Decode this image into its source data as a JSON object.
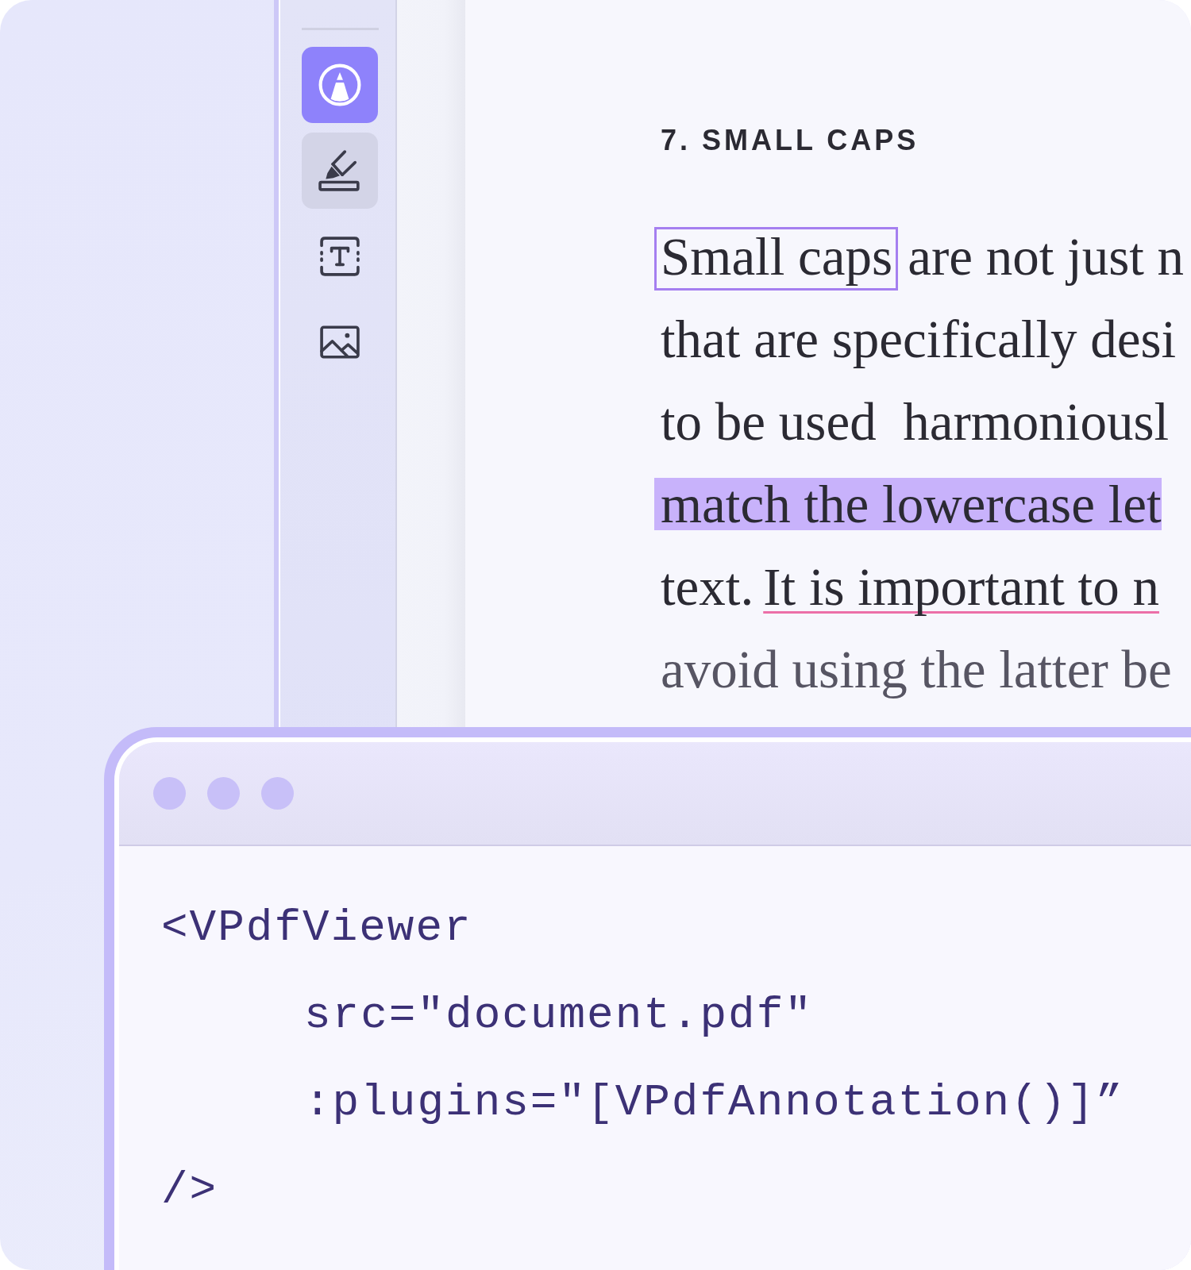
{
  "toolbar": {
    "tools": [
      {
        "kind": "pen",
        "selected": true,
        "hovered": false
      },
      {
        "kind": "highlighter",
        "selected": false,
        "hovered": true
      },
      {
        "kind": "text",
        "selected": false,
        "hovered": false
      },
      {
        "kind": "image",
        "selected": false,
        "hovered": false
      }
    ]
  },
  "page": {
    "heading": "7. SMALL CAPS",
    "lines": [
      {
        "dimmed": false,
        "segments": [
          {
            "kind": "boxed",
            "text": "Small caps"
          },
          {
            "kind": "plain",
            "text": "are not just n"
          }
        ]
      },
      {
        "dimmed": false,
        "segments": [
          {
            "kind": "plain",
            "text": "that are specifically desi"
          }
        ]
      },
      {
        "dimmed": false,
        "segments": [
          {
            "kind": "plain",
            "text": "to be used  harmoniousl"
          }
        ]
      },
      {
        "dimmed": false,
        "segments": [
          {
            "kind": "highlight",
            "text": "match the lowercase let"
          }
        ]
      },
      {
        "dimmed": false,
        "segments": [
          {
            "kind": "plain",
            "text": "text."
          },
          {
            "kind": "underline",
            "text": "It is important to n"
          }
        ]
      },
      {
        "dimmed": true,
        "segments": [
          {
            "kind": "plain",
            "text": "avoid using the latter be"
          }
        ]
      }
    ]
  },
  "code_window": {
    "tag_open": "<VPdfViewer",
    "attributes": [
      "src=\"document.pdf\"",
      ":plugins=\"[VPdfAnnotation()]”"
    ],
    "tag_close": "/>"
  }
}
